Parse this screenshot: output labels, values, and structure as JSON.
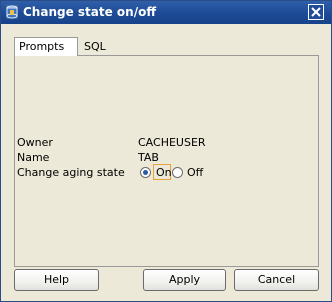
{
  "window": {
    "title": "Change state on/off"
  },
  "tabs": [
    {
      "label": "Prompts",
      "selected": true
    },
    {
      "label": "SQL",
      "selected": false
    }
  ],
  "form": {
    "owner_label": "Owner",
    "owner_value": "CACHEUSER",
    "name_label": "Name",
    "name_value": "TAB",
    "aging_label": "Change aging state",
    "aging_options": [
      {
        "label": "On",
        "selected": true
      },
      {
        "label": "Off",
        "selected": false
      }
    ]
  },
  "buttons": {
    "help": "Help",
    "apply": "Apply",
    "cancel": "Cancel"
  },
  "colors": {
    "titlebar": "#1f4c98",
    "background": "#ece9d8",
    "focus": "#e6a23c",
    "radio_dot": "#2a5aa8"
  }
}
